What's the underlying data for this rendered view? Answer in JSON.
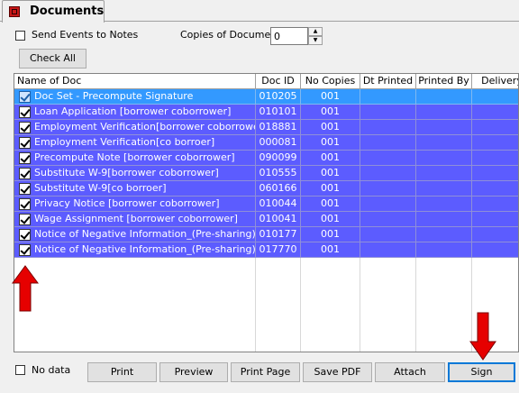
{
  "tab": {
    "label": "Documents"
  },
  "options": {
    "send_events_label": "Send Events to Notes",
    "copies_label": "Copies of Document",
    "copies_value": "0",
    "check_all_label": "Check All"
  },
  "grid": {
    "columns": [
      "Name of Doc",
      "Doc ID",
      "No Copies",
      "Dt Printed",
      "Printed By",
      "Delivery M"
    ],
    "rows": [
      {
        "name": "Doc Set - Precompute Signature",
        "id": "010205",
        "copies": "001"
      },
      {
        "name": "Loan Application [borrower coborrower]",
        "id": "010101",
        "copies": "001"
      },
      {
        "name": "Employment Verification[borrower coborrower]",
        "id": "018881",
        "copies": "001"
      },
      {
        "name": "Employment Verification[co borroer]",
        "id": "000081",
        "copies": "001"
      },
      {
        "name": "Precompute Note  [borrower coborrower]",
        "id": "090099",
        "copies": "001"
      },
      {
        "name": "Substitute W-9[borrower coborrower]",
        "id": "010555",
        "copies": "001"
      },
      {
        "name": "Substitute W-9[co borroer]",
        "id": "060166",
        "copies": "001"
      },
      {
        "name": "Privacy Notice [borrower coborrower]",
        "id": "010044",
        "copies": "001"
      },
      {
        "name": "Wage Assignment [borrower coborrower]",
        "id": "010041",
        "copies": "001"
      },
      {
        "name": "Notice of Negative Information_(Pre-sharing)",
        "id": "010177",
        "copies": "001"
      },
      {
        "name": "Notice of Negative Information_(Pre-sharing)",
        "id": "017770",
        "copies": "001"
      }
    ]
  },
  "footer": {
    "no_data_label": "No data",
    "buttons": [
      "Print",
      "Preview",
      "Print Page",
      "Save PDF",
      "Attach",
      "Sign"
    ]
  },
  "colors": {
    "row_selected": "#5c5cff",
    "row_focused": "#3399ff",
    "arrow": "#e60000"
  },
  "icons": {
    "tab": "document-icon",
    "arrows": "red-arrow-icon"
  }
}
